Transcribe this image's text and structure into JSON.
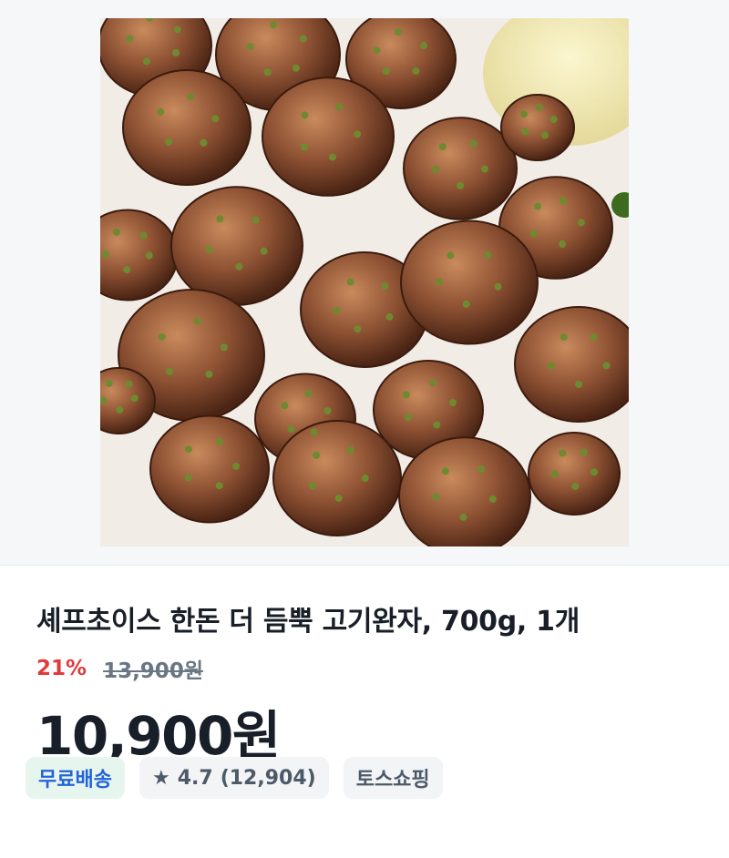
{
  "product": {
    "image_alt": "고기완자",
    "title": "셰프초이스 한돈 더 듬뿍 고기완자, 700g, 1개",
    "discount_rate": "21%",
    "original_price": "13,900원",
    "price": "10,900원"
  },
  "chips": {
    "shipping": "무료배송",
    "rating_icon": "star-icon",
    "rating": "4.7",
    "review_count": "(12,904)",
    "shop": "토스쇼핑"
  },
  "colors": {
    "discount": "#e03b3b",
    "shipping_text": "#2563d9",
    "shipping_bg": "#e6f6ef"
  }
}
